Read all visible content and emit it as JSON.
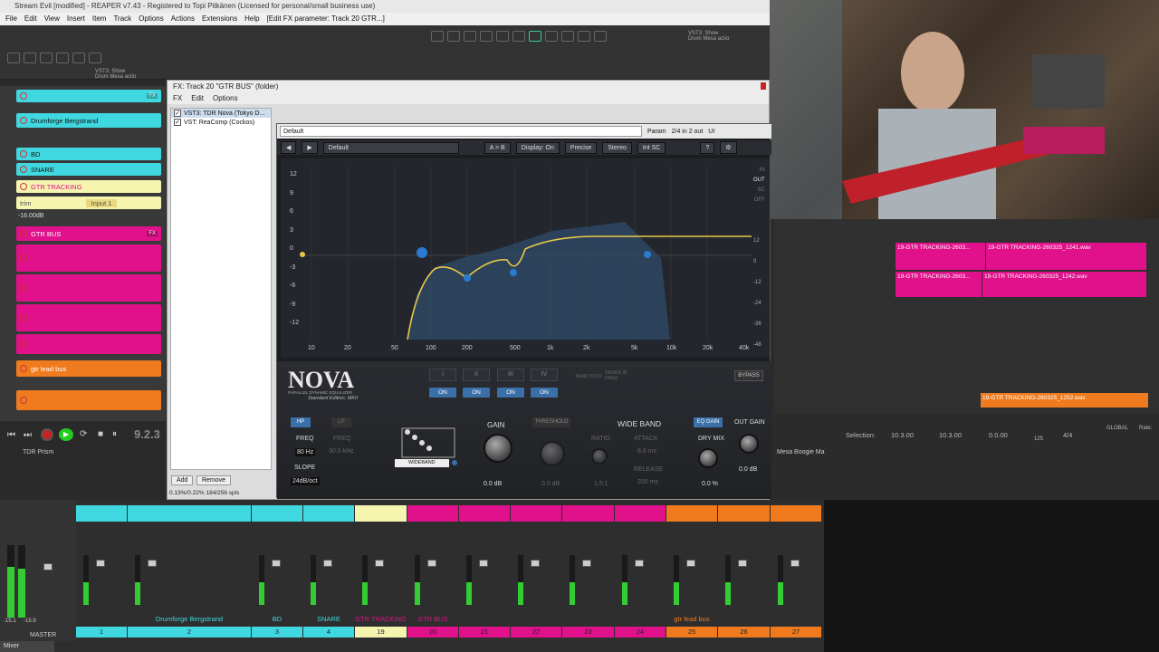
{
  "window": {
    "title": "Stream Evil [modified] - REAPER v7.43 - Registered to Topi Pitkänen (Licensed for personal/small business use)",
    "menu": [
      "File",
      "Edit",
      "View",
      "Insert",
      "Item",
      "Track",
      "Options",
      "Actions",
      "Extensions",
      "Help",
      "[Edit FX parameter: Track 20 GTR...]"
    ]
  },
  "toolbar": {
    "vst_label_1": "VST3: Show",
    "vst_label_2": "Drum Mesa actio"
  },
  "tracks": [
    {
      "name": "Drumforge Bergstrand",
      "color": "#40d8e0"
    },
    {
      "name": "BD",
      "color": "#40d8e0"
    },
    {
      "name": "SNARE",
      "color": "#40d8e0"
    },
    {
      "name": "GTR TRACKING",
      "color": "#f5f5b0",
      "text_color": "#e0118a"
    },
    {
      "name": "trim",
      "color": "#f5f5b0"
    },
    {
      "name": "Input 1",
      "color": "#f5f5b0"
    },
    {
      "name": "-16.00dB",
      "color": "#f5f5b0"
    },
    {
      "name": "GTR BUS",
      "color": "#e0118a"
    },
    {
      "name": "gtr lead bus",
      "color": "#f07b1e"
    }
  ],
  "fx_window": {
    "title": "FX: Track 20 \"GTR BUS\" (folder)",
    "menu": [
      "FX",
      "Edit",
      "Options"
    ],
    "chain": [
      {
        "name": "VST3: TDR Nova (Tokyo D...",
        "checked": true
      },
      {
        "name": "VST: ReaComp (Cockos)",
        "checked": true
      }
    ],
    "add_label": "Add",
    "remove_label": "Remove",
    "cpu_status": "0.13%/0.22% 184/256 spls",
    "preset": "Default",
    "param_label": "Param",
    "io_label": "2/4 in 2 out",
    "ui_label": "UI"
  },
  "nova": {
    "preset": "Default",
    "buttons": [
      "A > B",
      "Display: On",
      "Precise",
      "Stereo",
      "Int SC"
    ],
    "logo": "NOVA",
    "subtitle": "PARALLEL DYNAMIC EQUALIZER",
    "edition": "Standard Edition, MKII",
    "gain_scale": [
      "12",
      "9",
      "6",
      "3",
      "0",
      "-3",
      "-6",
      "-9",
      "-12"
    ],
    "right_scale": [
      "IN",
      "OUT",
      "SC",
      "OFF",
      "12",
      "0",
      "-12",
      "-24",
      "-36",
      "-48"
    ],
    "freq_labels": [
      "10",
      "20",
      "50",
      "100",
      "200",
      "500",
      "1k",
      "2k",
      "5k",
      "10k",
      "20k",
      "40k"
    ],
    "bands": [
      "I",
      "II",
      "III",
      "IV"
    ],
    "band_on": "ON",
    "band_solo": "BAND SOLO",
    "order": "ORDER IN FREQ",
    "bypass": "BYPASS",
    "hp": "HP",
    "lp": "LP",
    "freq_label": "FREQ",
    "freq_value": "80 Hz",
    "lp_freq_value": "30.0 kHz",
    "slope_label": "SLOPE",
    "slope_value": "24dB/oct",
    "wideband_label": "WIDEBAND",
    "gain_label": "GAIN",
    "gain_value": "0.0 dB",
    "threshold_label": "THRESHOLD",
    "threshold_value": "0.0 dB",
    "wide_band_title": "WIDE BAND",
    "ratio_label": "RATIO",
    "ratio_value": "1.5:1",
    "attack_label": "ATTACK",
    "attack_value": "8.0 ms",
    "release_label": "RELEASE",
    "release_value": "200 ms",
    "eq_gain_label": "EQ GAIN",
    "dry_mix_label": "DRY MIX",
    "dry_mix_value": "0.0 %",
    "out_gain_label": "OUT GAIN",
    "out_gain_value": "0.0 dB"
  },
  "arrange": {
    "clips": [
      "19-GTR TRACKING-2603...",
      "19-GTR TRACKING-260325_1241.wav",
      "19-GTR TRACKING-2603...",
      "19-GTR TRACKING-260325_1242.wav",
      "19-GTR TRACKING-260325_1252.wav"
    ]
  },
  "selection": {
    "label": "Selection:",
    "start": "10.3.00",
    "end": "10.3.00",
    "length": "0.0.00",
    "bpm": "125",
    "sig": "4/4",
    "global": "GLOBAL",
    "rate": "Rate:"
  },
  "transport": {
    "position": "9.2.3",
    "track_label": "TDR Prism",
    "mesa_label": "Mesa Boogie Ma"
  },
  "mixer": {
    "master_label": "MASTER",
    "mixer_tab": "Mixer",
    "master_db_left": "-15.1",
    "master_db_right": "-15.9",
    "strips": [
      {
        "name": "",
        "num": "1",
        "color": "#40d8e0"
      },
      {
        "name": "Drumforge Bergstrand",
        "num": "2",
        "color": "#40d8e0"
      },
      {
        "name": "BD",
        "num": "3",
        "color": "#40d8e0"
      },
      {
        "name": "SNARE",
        "num": "4",
        "color": "#40d8e0"
      },
      {
        "name": "GTR TRACKING",
        "num": "19",
        "color": "#f5f5b0"
      },
      {
        "name": "GTR BUS",
        "num": "20",
        "color": "#e0118a"
      },
      {
        "name": "",
        "num": "21",
        "color": "#e0118a"
      },
      {
        "name": "",
        "num": "22",
        "color": "#e0118a"
      },
      {
        "name": "",
        "num": "23",
        "color": "#e0118a"
      },
      {
        "name": "",
        "num": "24",
        "color": "#e0118a"
      },
      {
        "name": "gtr lead bus",
        "num": "25",
        "color": "#f07b1e"
      },
      {
        "name": "",
        "num": "26",
        "color": "#f07b1e"
      },
      {
        "name": "",
        "num": "27",
        "color": "#f07b1e"
      }
    ]
  }
}
